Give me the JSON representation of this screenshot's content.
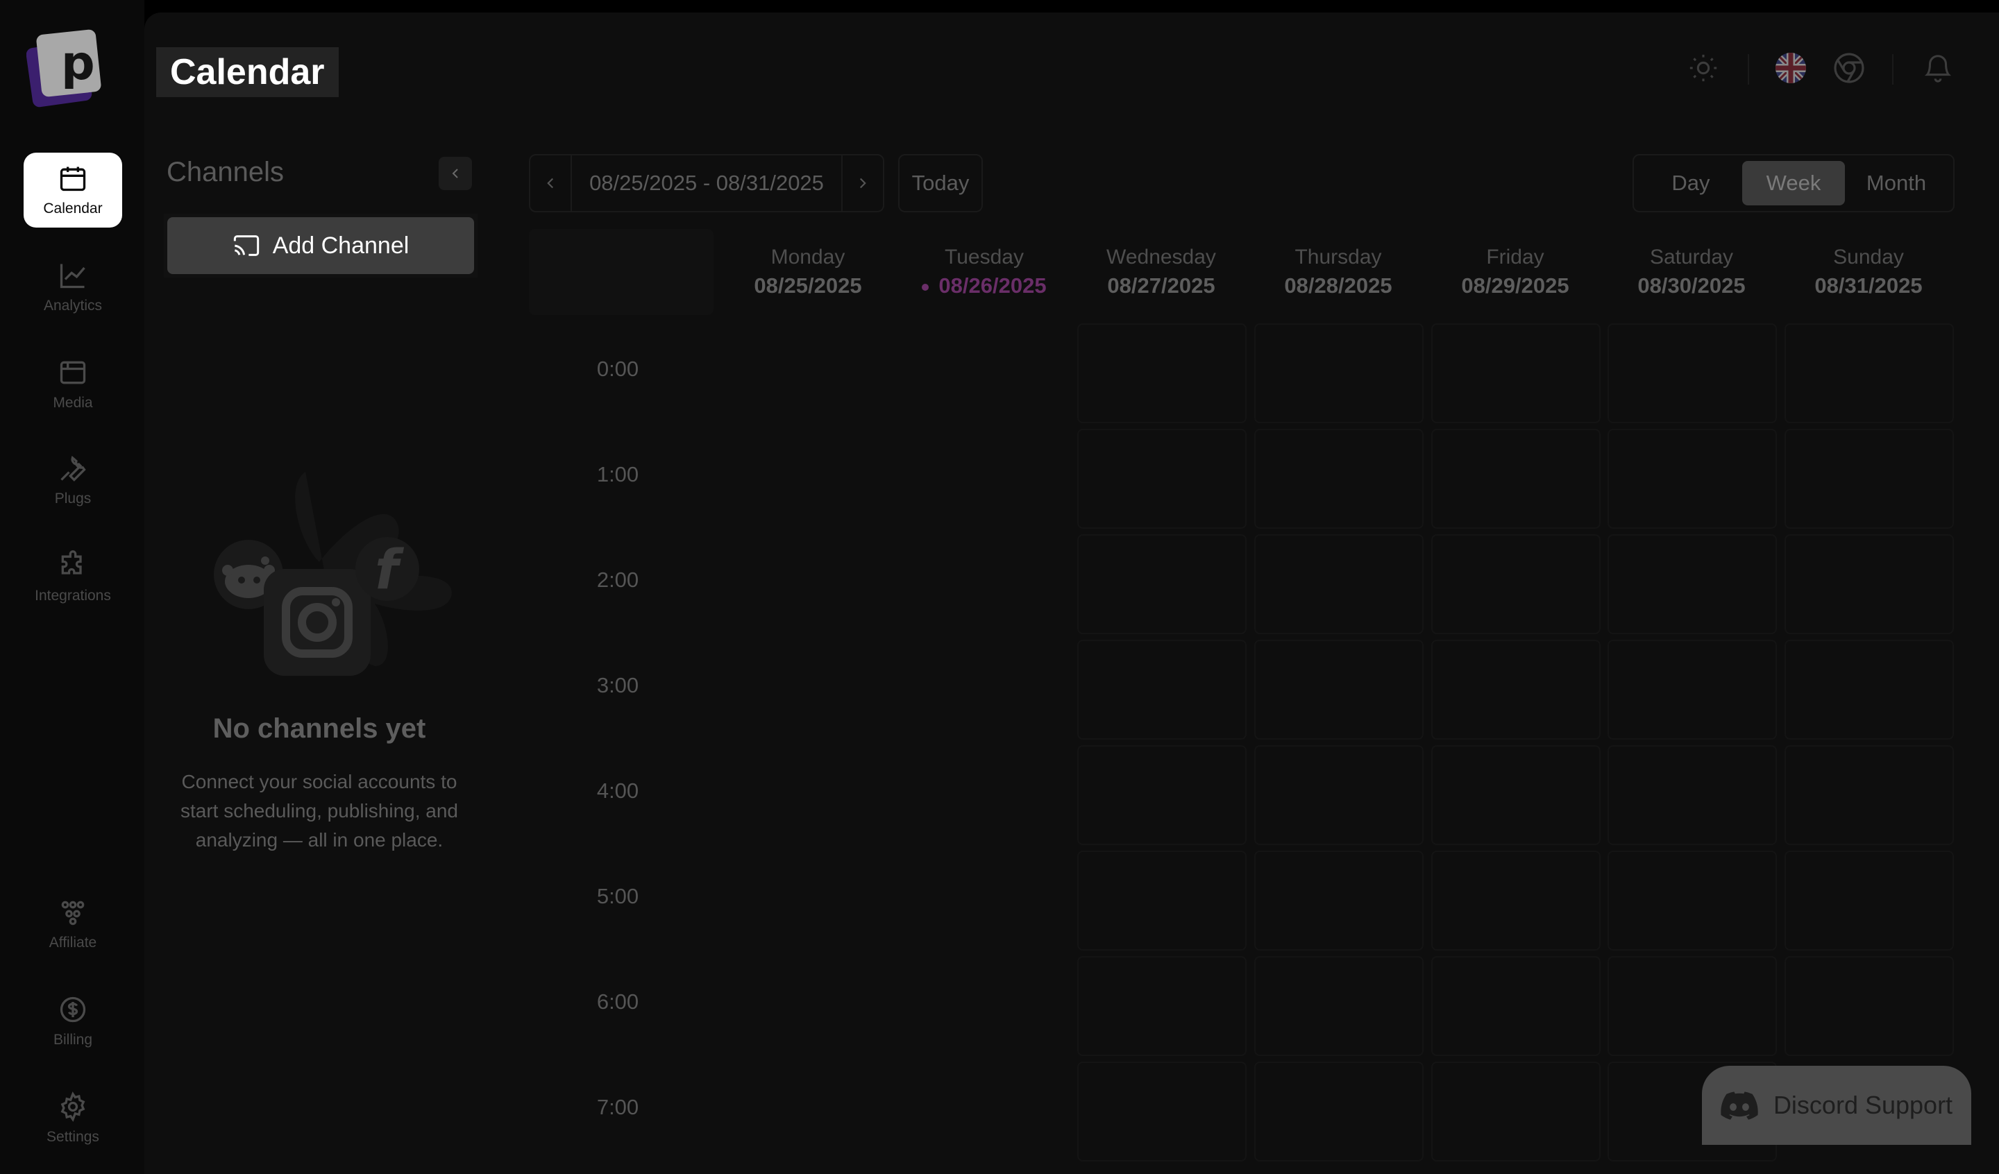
{
  "header": {
    "title": "Calendar"
  },
  "sidebar": {
    "logo_letter": "p",
    "items_top": [
      {
        "label": "Calendar",
        "icon": "calendar-icon",
        "active": true
      },
      {
        "label": "Analytics",
        "icon": "analytics-icon"
      },
      {
        "label": "Media",
        "icon": "media-icon"
      },
      {
        "label": "Plugs",
        "icon": "wrench-icon"
      },
      {
        "label": "Integrations",
        "icon": "puzzle-icon"
      }
    ],
    "items_bottom": [
      {
        "label": "Affiliate",
        "icon": "affiliate-icon"
      },
      {
        "label": "Billing",
        "icon": "dollar-icon"
      },
      {
        "label": "Settings",
        "icon": "gear-icon"
      }
    ]
  },
  "channels": {
    "title": "Channels",
    "add_label": "Add Channel",
    "empty_title": "No channels yet",
    "empty_desc": "Connect your social accounts to start scheduling, publishing, and analyzing — all in one place."
  },
  "toolbar": {
    "date_range": "08/25/2025 - 08/31/2025",
    "today_label": "Today",
    "views": [
      "Day",
      "Week",
      "Month"
    ],
    "active_view": "Week"
  },
  "week": {
    "days": [
      {
        "name": "Monday",
        "date": "08/25/2025"
      },
      {
        "name": "Tuesday",
        "date": "08/26/2025",
        "current": true
      },
      {
        "name": "Wednesday",
        "date": "08/27/2025"
      },
      {
        "name": "Thursday",
        "date": "08/28/2025"
      },
      {
        "name": "Friday",
        "date": "08/29/2025"
      },
      {
        "name": "Saturday",
        "date": "08/30/2025"
      },
      {
        "name": "Sunday",
        "date": "08/31/2025"
      }
    ],
    "hours": [
      "0:00",
      "1:00",
      "2:00",
      "3:00",
      "4:00",
      "5:00",
      "6:00",
      "7:00"
    ]
  },
  "discord": {
    "label": "Discord Support"
  },
  "colors": {
    "accent_current_day": "#6a2e68",
    "logo_purple": "#3b1f6e"
  }
}
